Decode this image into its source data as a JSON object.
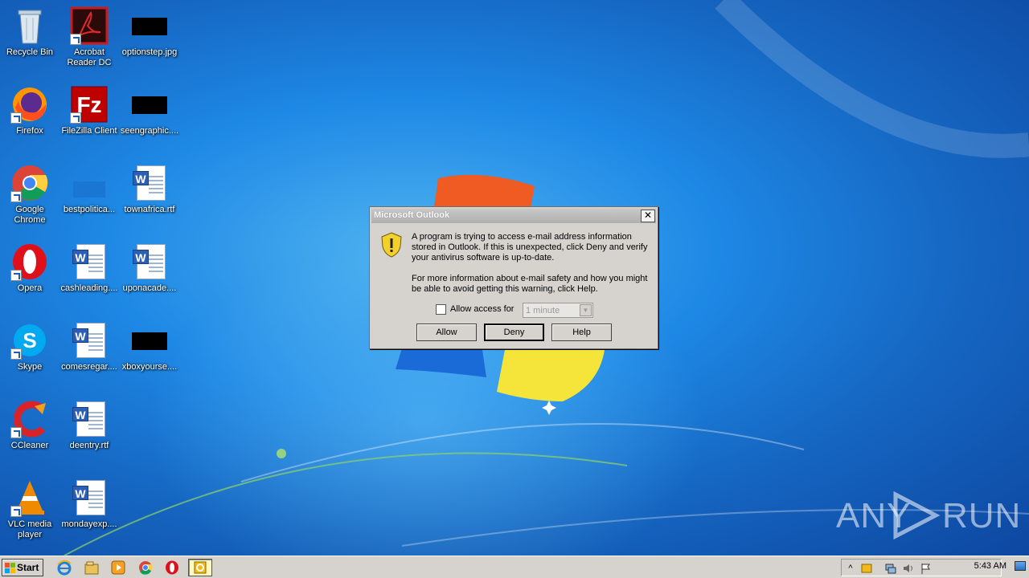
{
  "desktop": {
    "icons": [
      {
        "label": "Recycle Bin",
        "icon": "recycle-bin-icon"
      },
      {
        "label": "Acrobat Reader DC",
        "icon": "acrobat-reader-icon"
      },
      {
        "label": "optionstep.jpg",
        "icon": "image-file-icon"
      },
      {
        "label": "Firefox",
        "icon": "firefox-icon"
      },
      {
        "label": "FileZilla Client",
        "icon": "filezilla-icon"
      },
      {
        "label": "seengraphic....",
        "icon": "image-file-icon"
      },
      {
        "label": "Google Chrome",
        "icon": "chrome-icon"
      },
      {
        "label": "bestpolitica...",
        "icon": "folder-icon"
      },
      {
        "label": "townafrica.rtf",
        "icon": "word-document-icon"
      },
      {
        "label": "Opera",
        "icon": "opera-icon"
      },
      {
        "label": "cashleading....",
        "icon": "word-document-icon"
      },
      {
        "label": "uponacade....",
        "icon": "word-document-icon"
      },
      {
        "label": "Skype",
        "icon": "skype-icon"
      },
      {
        "label": "comesregar....",
        "icon": "word-document-icon"
      },
      {
        "label": "xboxyourse....",
        "icon": "image-file-icon"
      },
      {
        "label": "CCleaner",
        "icon": "ccleaner-icon"
      },
      {
        "label": "deentry.rtf",
        "icon": "word-document-icon"
      },
      {
        "label": "VLC media player",
        "icon": "vlc-icon"
      },
      {
        "label": "mondayexp....",
        "icon": "word-document-icon"
      }
    ]
  },
  "dialog": {
    "title": "Microsoft Outlook",
    "close_glyph": "✕",
    "message_1": "A program is trying to access e-mail address information stored in Outlook. If this is unexpected, click Deny and verify your antivirus software is up-to-date.",
    "message_2": "For more information about e-mail safety and how you might be able to avoid getting this warning, click Help.",
    "allow_access_label": "Allow access for",
    "allow_access_checked": false,
    "duration_value": "1 minute",
    "buttons": {
      "allow": "Allow",
      "deny": "Deny",
      "help": "Help"
    }
  },
  "watermark": {
    "left": "ANY",
    "right": "RUN"
  },
  "taskbar": {
    "start_label": "Start",
    "pinned": [
      "internet-explorer-icon",
      "explorer-icon",
      "media-player-icon",
      "chrome-icon",
      "opera-icon",
      "outlook-icon"
    ],
    "clock": "5:43 AM"
  },
  "colors": {
    "accent_blue": "#1565c0",
    "dialog_gray": "#d6d3ce"
  }
}
